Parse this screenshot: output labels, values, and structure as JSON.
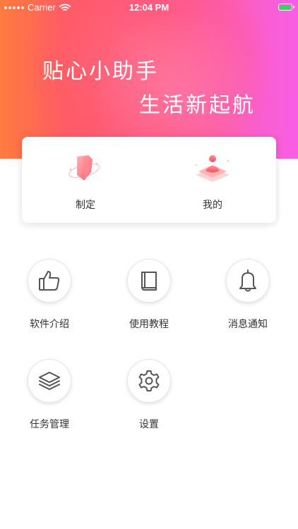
{
  "status_bar": {
    "carrier": "Carrier",
    "time": "12:04 PM",
    "wifi_icon": "wifi-icon",
    "battery_icon": "battery-charging-icon"
  },
  "hero": {
    "line1": "贴心小助手",
    "line2": "生活新起航"
  },
  "card": {
    "items": [
      {
        "label": "制定",
        "icon": "shield-icon"
      },
      {
        "label": "我的",
        "icon": "user-profile-icon"
      }
    ]
  },
  "grid": {
    "items": [
      {
        "label": "软件介绍",
        "icon": "thumbs-up-icon"
      },
      {
        "label": "使用教程",
        "icon": "book-icon"
      },
      {
        "label": "消息通知",
        "icon": "bell-icon"
      },
      {
        "label": "任务管理",
        "icon": "layers-icon"
      },
      {
        "label": "设置",
        "icon": "gear-icon"
      }
    ]
  },
  "colors": {
    "gradient_start": "#ff7b3f",
    "gradient_mid": "#ff4f83",
    "gradient_end": "#f85ee4",
    "icon_stroke": "#555555",
    "text": "#333333"
  }
}
